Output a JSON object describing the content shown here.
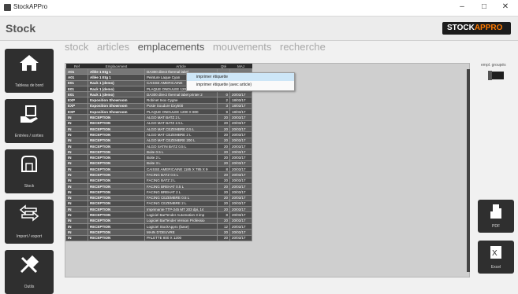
{
  "window": {
    "title": "StockAPPro",
    "minimize": "–",
    "maximize": "□",
    "close": "✕"
  },
  "header": {
    "title": "Stock",
    "logo_part1": "STOCK",
    "logo_part2": "APPRO",
    "logo_accent": "#ff7a00"
  },
  "sidebar": {
    "items": [
      {
        "label": "Tableau de bord",
        "icon": "home-icon"
      },
      {
        "label": "Entrées / sorties",
        "icon": "box-hand-icon"
      },
      {
        "label": "Stock",
        "icon": "warehouse-icon"
      },
      {
        "label": "Import / export",
        "icon": "arrows-icon"
      },
      {
        "label": "Outils",
        "icon": "tools-icon"
      }
    ]
  },
  "tabs": [
    {
      "label": "stock",
      "active": false
    },
    {
      "label": "articles",
      "active": false
    },
    {
      "label": "emplacements",
      "active": true
    },
    {
      "label": "mouvements",
      "active": false
    },
    {
      "label": "recherche",
      "active": false
    }
  ],
  "table": {
    "columns": [
      "Ref",
      "Emplacement",
      "Article",
      "Qté",
      "MAJ"
    ],
    "rows": [
      [
        "A01",
        "Allée 1 Etg 1",
        "DA300 direct thermal label...",
        "",
        ""
      ],
      [
        "A01",
        "Allée 1 Etg 1",
        "Peinture Laque Cyan",
        "",
        ""
      ],
      [
        "E01",
        "Rack 1 (demo)",
        "CAISSE AMERICAINE",
        "",
        ""
      ],
      [
        "E01",
        "Rack 1 (demo)",
        "PLAQUE ONDULEE 1200 X 800",
        "7",
        "20/03/17"
      ],
      [
        "E01",
        "Rack 1 (demo)",
        "DA300 direct thermal label printer 2",
        "0",
        "20/03/17"
      ],
      [
        "EXP",
        "Exposition Showroom",
        "Robinet Inox Cygne",
        "2",
        "18/03/17"
      ],
      [
        "EXP",
        "Exposition Showroom",
        "Poste Soudure Dxy500",
        "3",
        "18/03/17"
      ],
      [
        "EXP",
        "Exposition Showroom",
        "PLAQUE ONDULEE 1200 X 800",
        "9",
        "18/03/17"
      ],
      [
        "IN",
        "RECEPTION",
        "ALGO MAT BATZ 2 L",
        "20",
        "20/03/17"
      ],
      [
        "IN",
        "RECEPTION",
        "ALGO MAT BATZ 2.5 L",
        "20",
        "20/03/17"
      ],
      [
        "IN",
        "RECEPTION",
        "ALGO MAT CEZEMBRE 0.5 L",
        "20",
        "20/03/17"
      ],
      [
        "IN",
        "RECEPTION",
        "ALGO MAT CEZEMBRE 2 L",
        "20",
        "20/03/17"
      ],
      [
        "IN",
        "RECEPTION",
        "ALGO MAT CEZEMBRE 200 L",
        "20",
        "20/03/17"
      ],
      [
        "IN",
        "RECEPTION",
        "ALGO SATIN BATZ 0.5 L",
        "20",
        "20/03/17"
      ],
      [
        "IN",
        "RECEPTION",
        "Boite 0.5 L",
        "20",
        "20/03/17"
      ],
      [
        "IN",
        "RECEPTION",
        "Boite 2 L",
        "20",
        "20/03/17"
      ],
      [
        "IN",
        "RECEPTION",
        "Boite 3 L",
        "20",
        "20/03/17"
      ],
      [
        "IN",
        "RECEPTION",
        "CAISSE AMERICAINE 1185 X 785 X 9",
        "8",
        "20/03/17"
      ],
      [
        "IN",
        "RECEPTION",
        "FACING BATZ 0.5 L",
        "20",
        "20/03/17"
      ],
      [
        "IN",
        "RECEPTION",
        "FACING BATZ 2 L",
        "20",
        "20/03/17"
      ],
      [
        "IN",
        "RECEPTION",
        "FACING BREHAT 0.5 L",
        "20",
        "20/03/17"
      ],
      [
        "IN",
        "RECEPTION",
        "FACING BREHAT 2 L",
        "20",
        "20/03/17"
      ],
      [
        "IN",
        "RECEPTION",
        "FACING CEZEMBRE 0.5 L",
        "20",
        "20/03/17"
      ],
      [
        "IN",
        "RECEPTION",
        "FACING CEZEMBRE 2 L",
        "20",
        "20/03/17"
      ],
      [
        "IN",
        "RECEPTION",
        "Imprimante TTP-245 MT 203 dpi, 14",
        "20",
        "20/03/17"
      ],
      [
        "IN",
        "RECEPTION",
        "Logiciel BarTender Automation 3 imp",
        "8",
        "20/03/17"
      ],
      [
        "IN",
        "RECEPTION",
        "Logiciel BarTender Version Professio",
        "20",
        "20/03/17"
      ],
      [
        "IN",
        "RECEPTION",
        "Logiciel StockAppro (base)",
        "12",
        "20/03/17"
      ],
      [
        "IN",
        "RECEPTION",
        "MAIN D'OEUVRE",
        "20",
        "20/03/17"
      ],
      [
        "IN",
        "RECEPTION",
        "PALETTE 800 X 1200",
        "20",
        "20/03/17"
      ]
    ]
  },
  "context_menu": {
    "items": [
      "imprimer étiquette",
      "imprimer étiquette (avec article)"
    ]
  },
  "right_panel": {
    "group_label": "empl. groupés",
    "pdf_label": "PDF",
    "excel_label": "Excel"
  }
}
